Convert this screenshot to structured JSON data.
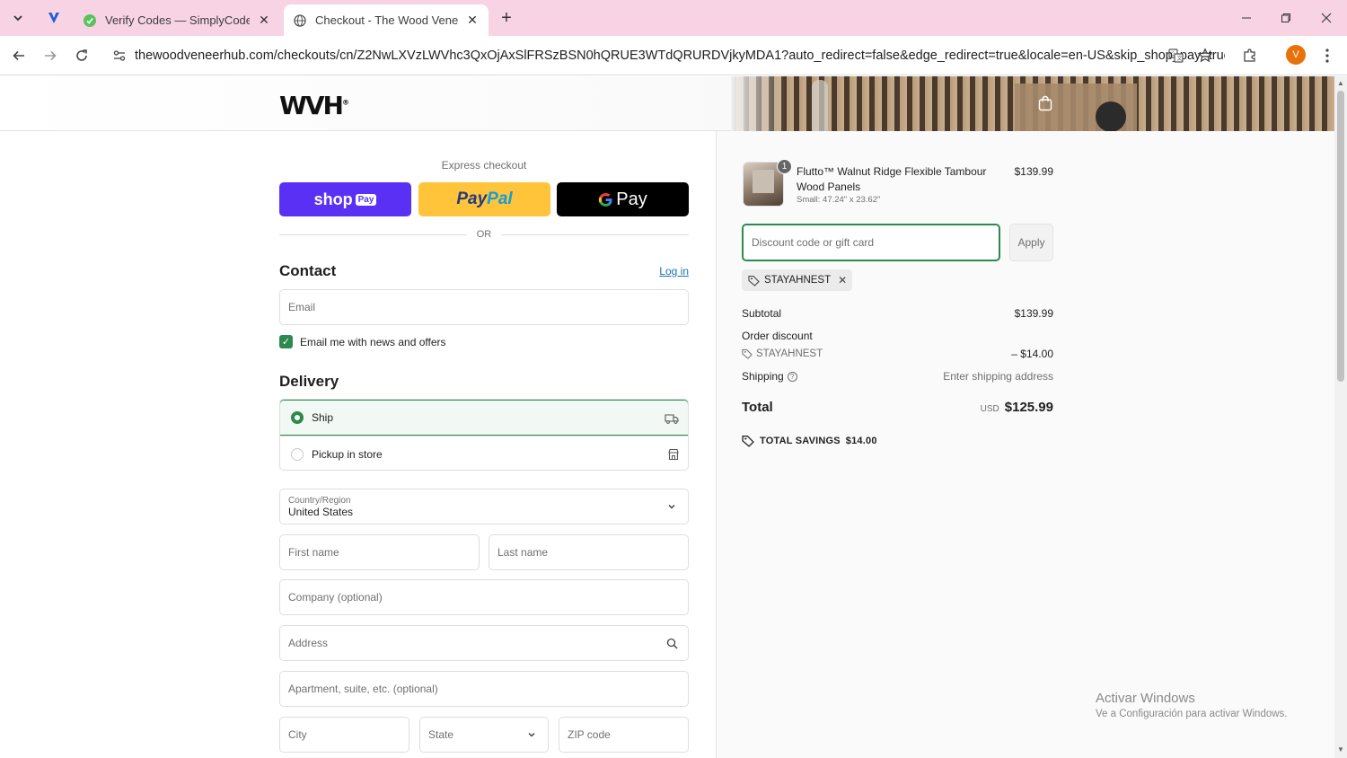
{
  "browser": {
    "tabs": [
      {
        "title": "Verify Codes — SimplyCodes",
        "active": false
      },
      {
        "title": "Checkout - The Wood Veneer H",
        "active": true
      }
    ],
    "url": "thewoodveneerhub.com/checkouts/cn/Z2NwLXVzLWVhc3QxOjAxSlFRSzBSN0hQRUE3WTdQRURDVjkyMDA1?auto_redirect=false&edge_redirect=true&locale=en-US&skip_shop_pay=true",
    "profile_initial": "V"
  },
  "header": {
    "logo_text": "WVH",
    "logo_mark": "®"
  },
  "express": {
    "label": "Express checkout",
    "shop_pay": {
      "text": "shop",
      "badge": "Pay"
    },
    "paypal": {
      "text_pay": "Pay",
      "text_pal": "Pal"
    },
    "gpay": {
      "text": "Pay"
    },
    "or_text": "OR"
  },
  "contact": {
    "title": "Contact",
    "login_link": "Log in",
    "email_placeholder": "Email",
    "newsletter_label": "Email me with news and offers",
    "newsletter_checked": true
  },
  "delivery": {
    "title": "Delivery",
    "options": [
      {
        "label": "Ship",
        "selected": true
      },
      {
        "label": "Pickup in store",
        "selected": false
      }
    ],
    "country_label": "Country/Region",
    "country_value": "United States",
    "first_name": "First name",
    "last_name": "Last name",
    "company": "Company (optional)",
    "address": "Address",
    "apartment": "Apartment, suite, etc. (optional)",
    "city": "City",
    "state": "State",
    "zip": "ZIP code"
  },
  "order": {
    "product": {
      "quantity": "1",
      "name": "Flutto™ Walnut Ridge Flexible Tambour Wood Panels",
      "variant": "Small: 47.24\" x 23.62\"",
      "price": "$139.99"
    },
    "discount_placeholder": "Discount code or gift card",
    "apply_label": "Apply",
    "applied_code": "STAYAHNEST",
    "subtotal_label": "Subtotal",
    "subtotal_value": "$139.99",
    "order_discount_label": "Order discount",
    "discount_code": "STAYAHNEST",
    "discount_value": "– $14.00",
    "shipping_label": "Shipping",
    "shipping_value": "Enter shipping address",
    "total_label": "Total",
    "total_currency": "USD",
    "total_value": "$125.99",
    "savings_label": "TOTAL SAVINGS",
    "savings_value": "$14.00"
  },
  "windows_watermark": {
    "line1": "Activar Windows",
    "line2": "Ve a Configuración para activar Windows."
  },
  "colors": {
    "tabbar": "#f8d3e4",
    "shop_pay": "#5a31f4",
    "paypal": "#ffc439",
    "accent_green": "#2c8a4e",
    "link_blue": "#1773b0"
  }
}
